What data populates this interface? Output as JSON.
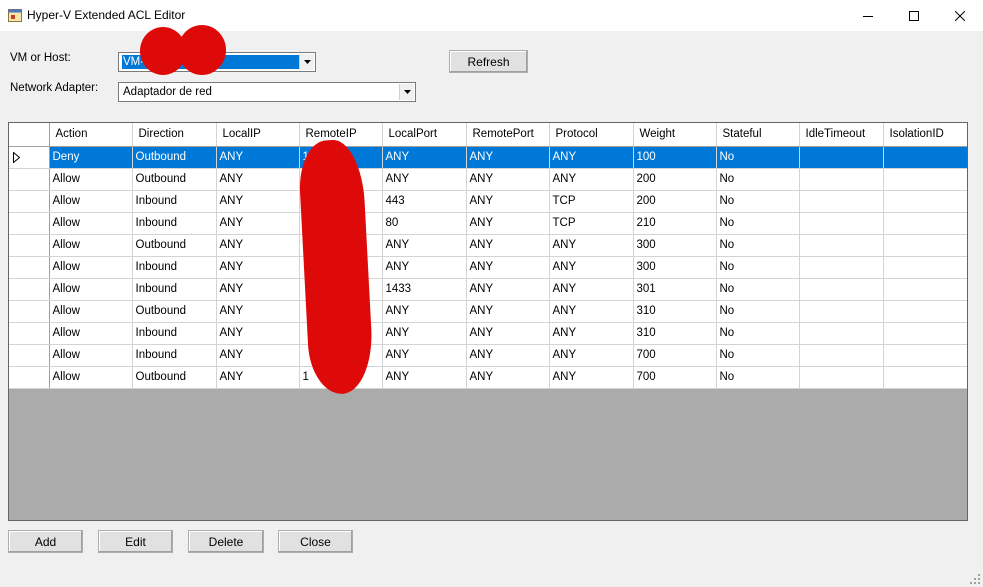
{
  "window": {
    "title": "Hyper-V Extended ACL Editor"
  },
  "form": {
    "vm_label": "VM or Host:",
    "vm_value": "VM-",
    "adapter_label": "Network Adapter:",
    "adapter_value": "Adaptador de red",
    "refresh_label": "Refresh"
  },
  "grid": {
    "columns": [
      "Action",
      "Direction",
      "LocalIP",
      "RemoteIP",
      "LocalPort",
      "RemotePort",
      "Protocol",
      "Weight",
      "Stateful",
      "IdleTimeout",
      "IsolationID"
    ],
    "rows": [
      [
        "Deny",
        "Outbound",
        "ANY",
        "1           24",
        "ANY",
        "ANY",
        "ANY",
        "100",
        "No",
        "",
        ""
      ],
      [
        "Allow",
        "Outbound",
        "ANY",
        "1",
        "ANY",
        "ANY",
        "ANY",
        "200",
        "No",
        "",
        ""
      ],
      [
        "Allow",
        "Inbound",
        "ANY",
        "A",
        "443",
        "ANY",
        "TCP",
        "200",
        "No",
        "",
        ""
      ],
      [
        "Allow",
        "Inbound",
        "ANY",
        "A",
        "80",
        "ANY",
        "TCP",
        "210",
        "No",
        "",
        ""
      ],
      [
        "Allow",
        "Outbound",
        "ANY",
        "",
        "ANY",
        "ANY",
        "ANY",
        "300",
        "No",
        "",
        ""
      ],
      [
        "Allow",
        "Inbound",
        "ANY",
        "",
        "ANY",
        "ANY",
        "ANY",
        "300",
        "No",
        "",
        ""
      ],
      [
        "Allow",
        "Inbound",
        "ANY",
        "",
        "1433",
        "ANY",
        "ANY",
        "301",
        "No",
        "",
        ""
      ],
      [
        "Allow",
        "Outbound",
        "ANY",
        "",
        "ANY",
        "ANY",
        "ANY",
        "310",
        "No",
        "",
        ""
      ],
      [
        "Allow",
        "Inbound",
        "ANY",
        "",
        "ANY",
        "ANY",
        "ANY",
        "310",
        "No",
        "",
        ""
      ],
      [
        "Allow",
        "Inbound",
        "ANY",
        "",
        "ANY",
        "ANY",
        "ANY",
        "700",
        "No",
        "",
        ""
      ],
      [
        "Allow",
        "Outbound",
        "ANY",
        "1",
        "ANY",
        "ANY",
        "ANY",
        "700",
        "No",
        "",
        ""
      ]
    ]
  },
  "buttons": {
    "add": "Add",
    "edit": "Edit",
    "delete": "Delete",
    "close": "Close"
  },
  "colors": {
    "selection": "#0078d7",
    "grid_background": "#ababab",
    "redaction": "#de0a0a"
  }
}
